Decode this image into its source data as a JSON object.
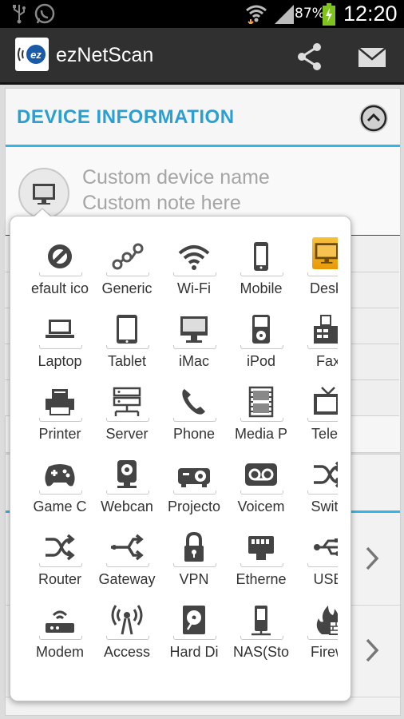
{
  "status_bar": {
    "battery_percent": "87%",
    "time": "12:20",
    "icons": [
      "usb-icon",
      "whatsapp-icon",
      "wifi-icon",
      "signal-icon",
      "battery-charging-icon"
    ]
  },
  "app_bar": {
    "title": "ezNetScan",
    "logo_text": "ez",
    "actions": [
      "share-icon",
      "email-icon"
    ]
  },
  "section": {
    "title": "DEVICE INFORMATION",
    "collapse_icon": "chevron-up-icon",
    "accent_color": "#33b5e5",
    "title_color": "#2aa0d2"
  },
  "device": {
    "name_placeholder": "Custom device name",
    "note_placeholder": "Custom note here",
    "icon": "desktop-icon"
  },
  "icon_picker": {
    "selected_index": 4,
    "selected_color": "#f0a91c",
    "items": [
      {
        "label": "efault ico",
        "icon": "default-icon"
      },
      {
        "label": "Generic",
        "icon": "generic-icon"
      },
      {
        "label": "Wi-Fi",
        "icon": "wifi-icon"
      },
      {
        "label": "Mobile",
        "icon": "mobile-icon"
      },
      {
        "label": "Deskt",
        "icon": "desktop-icon"
      },
      {
        "label": "Laptop",
        "icon": "laptop-icon"
      },
      {
        "label": "Tablet",
        "icon": "tablet-icon"
      },
      {
        "label": "iMac",
        "icon": "imac-icon"
      },
      {
        "label": "iPod",
        "icon": "ipod-icon"
      },
      {
        "label": "Fax",
        "icon": "fax-icon"
      },
      {
        "label": "Printer",
        "icon": "printer-icon"
      },
      {
        "label": "Server",
        "icon": "server-icon"
      },
      {
        "label": "Phone",
        "icon": "phone-icon"
      },
      {
        "label": "Media P",
        "icon": "media-player-icon"
      },
      {
        "label": "Telev",
        "icon": "television-icon"
      },
      {
        "label": "Game C",
        "icon": "game-controller-icon"
      },
      {
        "label": "Webcan",
        "icon": "webcam-icon"
      },
      {
        "label": "Projecto",
        "icon": "projector-icon"
      },
      {
        "label": "Voicem",
        "icon": "voicemail-icon"
      },
      {
        "label": "Switc",
        "icon": "switch-icon"
      },
      {
        "label": "Router",
        "icon": "router-icon"
      },
      {
        "label": "Gateway",
        "icon": "gateway-icon"
      },
      {
        "label": "VPN",
        "icon": "vpn-lock-icon"
      },
      {
        "label": "Etherne",
        "icon": "ethernet-icon"
      },
      {
        "label": "USB",
        "icon": "usb-icon"
      },
      {
        "label": "Modem",
        "icon": "modem-icon"
      },
      {
        "label": "Access",
        "icon": "access-point-icon"
      },
      {
        "label": "Hard Di",
        "icon": "hard-disk-icon"
      },
      {
        "label": "NAS(Sto",
        "icon": "nas-icon"
      },
      {
        "label": "Firew",
        "icon": "firewall-icon"
      }
    ]
  },
  "list_chevron_icon": "chevron-right-icon"
}
